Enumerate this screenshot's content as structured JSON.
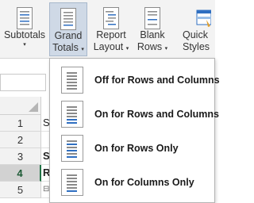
{
  "ribbon": {
    "buttons": [
      {
        "label1": "Subtotals",
        "label2": "",
        "has_caret": true
      },
      {
        "label1": "Grand",
        "label2": "Totals",
        "has_caret": true
      },
      {
        "label1": "Report",
        "label2": "Layout",
        "has_caret": true
      },
      {
        "label1": "Blank",
        "label2": "Rows",
        "has_caret": true
      },
      {
        "label1": "Quick",
        "label2": "Styles",
        "has_caret": false
      }
    ],
    "caret_glyph": "▾"
  },
  "sheet": {
    "rows": [
      {
        "num": "1",
        "cell": "S"
      },
      {
        "num": "2",
        "cell": ""
      },
      {
        "num": "3",
        "cell": "S"
      },
      {
        "num": "4",
        "cell": "R"
      },
      {
        "num": "5",
        "cell": "⊟"
      }
    ],
    "selected_row": "4"
  },
  "menu": {
    "items": [
      {
        "label": "Off for Rows and Columns",
        "icon": "grand-totals-off-icon"
      },
      {
        "label": "On for Rows and Columns",
        "icon": "grand-totals-on-rows-cols-icon"
      },
      {
        "label": "On for Rows Only",
        "icon": "grand-totals-rows-only-icon"
      },
      {
        "label": "On for Columns Only",
        "icon": "grand-totals-columns-only-icon"
      }
    ]
  },
  "colors": {
    "accent": "#217346",
    "line_blue": "#2f6fc1",
    "line_gray": "#8a8a8a"
  }
}
